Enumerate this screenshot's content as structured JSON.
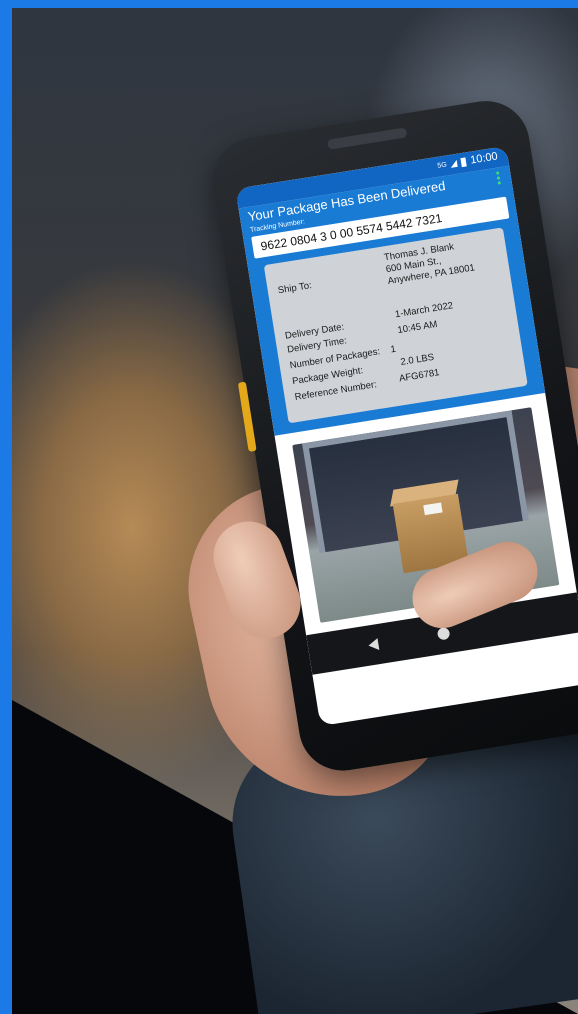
{
  "status_bar": {
    "network": "5G",
    "time": "10:00"
  },
  "app": {
    "title": "Your Package Has Been Delivered",
    "tracking_label": "Tracking Number:",
    "tracking_number": "9622 0804 3 0 00 5574 5442 7321"
  },
  "details": {
    "ship_to_label": "Ship To:",
    "ship_to_name": "Thomas J. Blank",
    "ship_to_street": "600 Main St.,",
    "ship_to_city": "Anywhere, PA 18001",
    "delivery_date_label": "Delivery Date:",
    "delivery_date": "1-March 2022",
    "delivery_time_label": "Delivery Time:",
    "delivery_time": "10:45 AM",
    "packages_label": "Number of Packages:",
    "packages": "1",
    "weight_label": "Package Weight:",
    "weight": "2.0 LBS",
    "reference_label": "Reference Number:",
    "reference": "AFG6781"
  },
  "colors": {
    "brand_blue": "#1c7ae6",
    "app_header": "#1a7bd4",
    "accent_green": "#39e07a"
  }
}
